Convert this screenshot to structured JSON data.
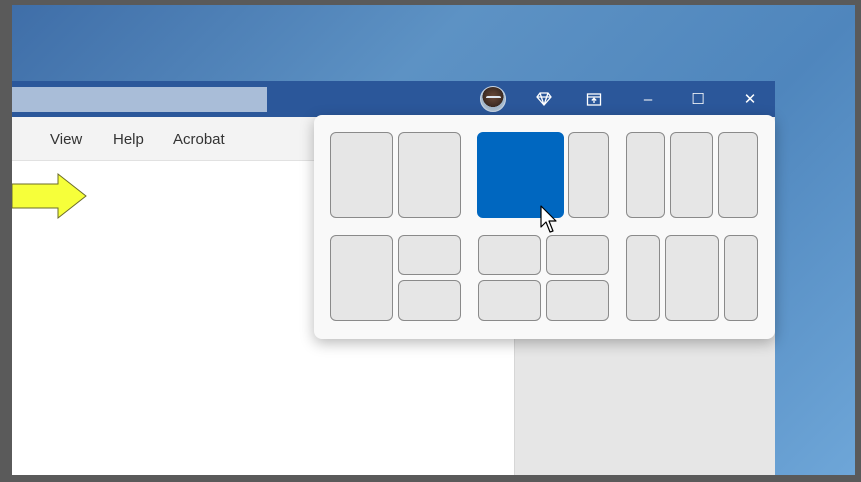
{
  "window": {
    "menu": [
      "View",
      "Help",
      "Acrobat"
    ],
    "controls": {
      "premium_icon": "diamond-icon",
      "share_icon": "share-icon",
      "minimize_glyph": "–",
      "maximize_glyph": "☐",
      "close_glyph": "✕"
    }
  },
  "snap_layouts": {
    "highlighted_zone": "layout-2-large-left",
    "accent_color": "#0067c0"
  },
  "annotation": {
    "arrow_color": "#f6ff3a"
  }
}
